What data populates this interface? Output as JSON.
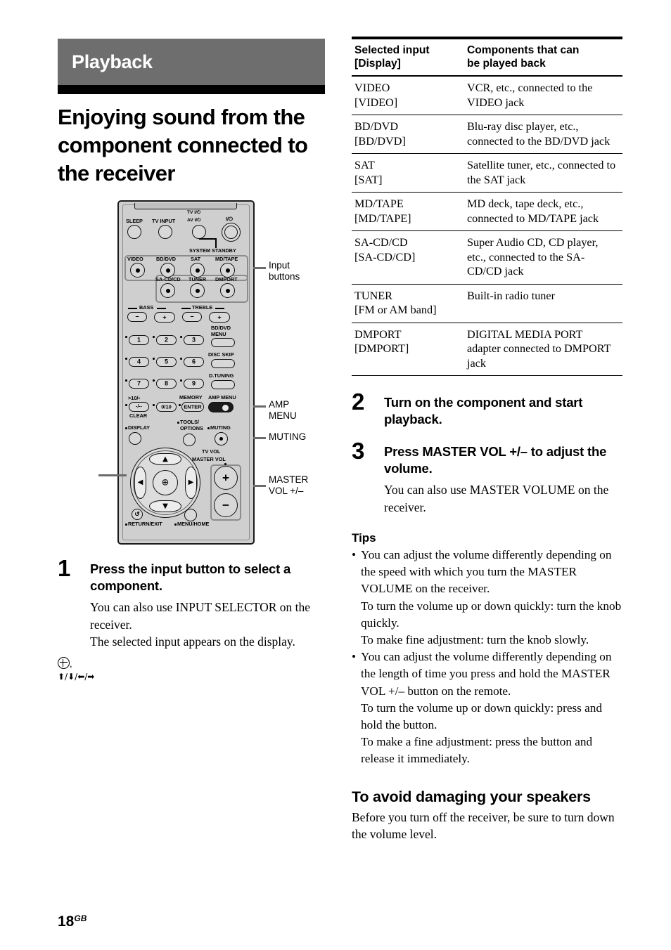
{
  "chapter": {
    "title": "Playback"
  },
  "section": {
    "title": "Enjoying sound from the component connected to the receiver"
  },
  "figure": {
    "remote_labels": {
      "sleep": "SLEEP",
      "tv_input": "TV INPUT",
      "tv_power": "TV I/⏻",
      "av_power": "AV I/⏻",
      "main_power": "I/⏻",
      "system_standby": "SYSTEM STANDBY",
      "video": "VIDEO",
      "bd_dvd": "BD/DVD",
      "sat": "SAT",
      "md_tape": "MD/TAPE",
      "sa_cd_cd": "SA-CD/CD",
      "tuner": "TUNER",
      "dmport": "DMPORT",
      "bass": "BASS",
      "treble": "TREBLE",
      "bd_dvd_menu": "BD/DVD\nMENU",
      "disc_skip": "DISC SKIP",
      "d_tuning": "D.TUNING",
      "num1": "1",
      "num2": "2",
      "num3": "3",
      "num4": "4",
      "num5": "5",
      "num6": "6",
      "num7": "7",
      "num8": "8",
      "num9": "9",
      "ten_more": ">10/▪",
      "minus_slash": "-/--",
      "clear": "CLEAR",
      "zero_ten": "0/10",
      "memory": "MEMORY",
      "enter": "ENTER",
      "amp_menu": "AMP MENU",
      "display": "DISPLAY",
      "tools_options": "TOOLS/\nOPTIONS",
      "muting": "MUTING",
      "tv_vol": "TV VOL",
      "master_vol": "MASTER VOL",
      "vol_plus": "+",
      "vol_minus": "−",
      "return_exit": "RETURN/EXIT",
      "menu_home": "MENU/HOME"
    },
    "callouts": {
      "input_buttons": "Input\nbuttons",
      "amp_menu": "AMP\nMENU",
      "muting": "MUTING",
      "master_vol": "MASTER\nVOL +/–",
      "nav_arrows": "⬆/⬇/⬅/➡"
    }
  },
  "steps": [
    {
      "num": "1",
      "head": "Press the input button to select a component.",
      "body": [
        "You can also use INPUT SELECTOR on the receiver.",
        "The selected input appears on the display."
      ]
    },
    {
      "num": "2",
      "head": "Turn on the component and start playback.",
      "body": []
    },
    {
      "num": "3",
      "head": "Press MASTER VOL +/– to adjust the volume.",
      "body": [
        "You can also use MASTER VOLUME on the receiver."
      ]
    }
  ],
  "table": {
    "headers": [
      "Selected input [Display]",
      "Components that can be played back"
    ],
    "header_lines": [
      [
        "Selected input",
        "[Display]"
      ],
      [
        "Components that can",
        "be played back"
      ]
    ],
    "rows": [
      {
        "input": "VIDEO\n[VIDEO]",
        "components": "VCR, etc., connected to the VIDEO jack"
      },
      {
        "input": "BD/DVD\n[BD/DVD]",
        "components": "Blu-ray disc player, etc., connected to the BD/DVD jack"
      },
      {
        "input": "SAT\n[SAT]",
        "components": "Satellite tuner, etc., connected to the SAT jack"
      },
      {
        "input": "MD/TAPE\n[MD/TAPE]",
        "components": "MD deck, tape deck, etc., connected to MD/TAPE jack"
      },
      {
        "input": "SA-CD/CD\n[SA-CD/CD]",
        "components": "Super Audio CD, CD player, etc., connected to the SA-CD/CD jack"
      },
      {
        "input": "TUNER\n[FM or AM band]",
        "components": "Built-in radio tuner"
      },
      {
        "input": "DMPORT\n[DMPORT]",
        "components": "DIGITAL MEDIA PORT adapter connected to DMPORT jack"
      }
    ]
  },
  "tips": {
    "heading": "Tips",
    "items": [
      "You can adjust the volume differently depending on the speed with which you turn the MASTER VOLUME on the receiver.\nTo turn the volume up or down quickly: turn the knob quickly.\nTo make fine adjustment: turn the knob slowly.",
      "You can adjust the volume differently depending on the length of time you press and hold the MASTER VOL +/– button on the remote.\nTo turn the volume up or down quickly: press and hold the button.\nTo make a fine adjustment: press the button and release it immediately."
    ]
  },
  "avoid_section": {
    "heading": "To avoid damaging your speakers",
    "body": "Before you turn off the receiver, be sure to turn down the volume level."
  },
  "footer": {
    "page": "18",
    "suffix": "GB"
  },
  "colors": {
    "banner": "#6e6e6e",
    "rule": "#000000",
    "remote_body": "#cfcfcf",
    "callout": "#6b6b6b"
  }
}
